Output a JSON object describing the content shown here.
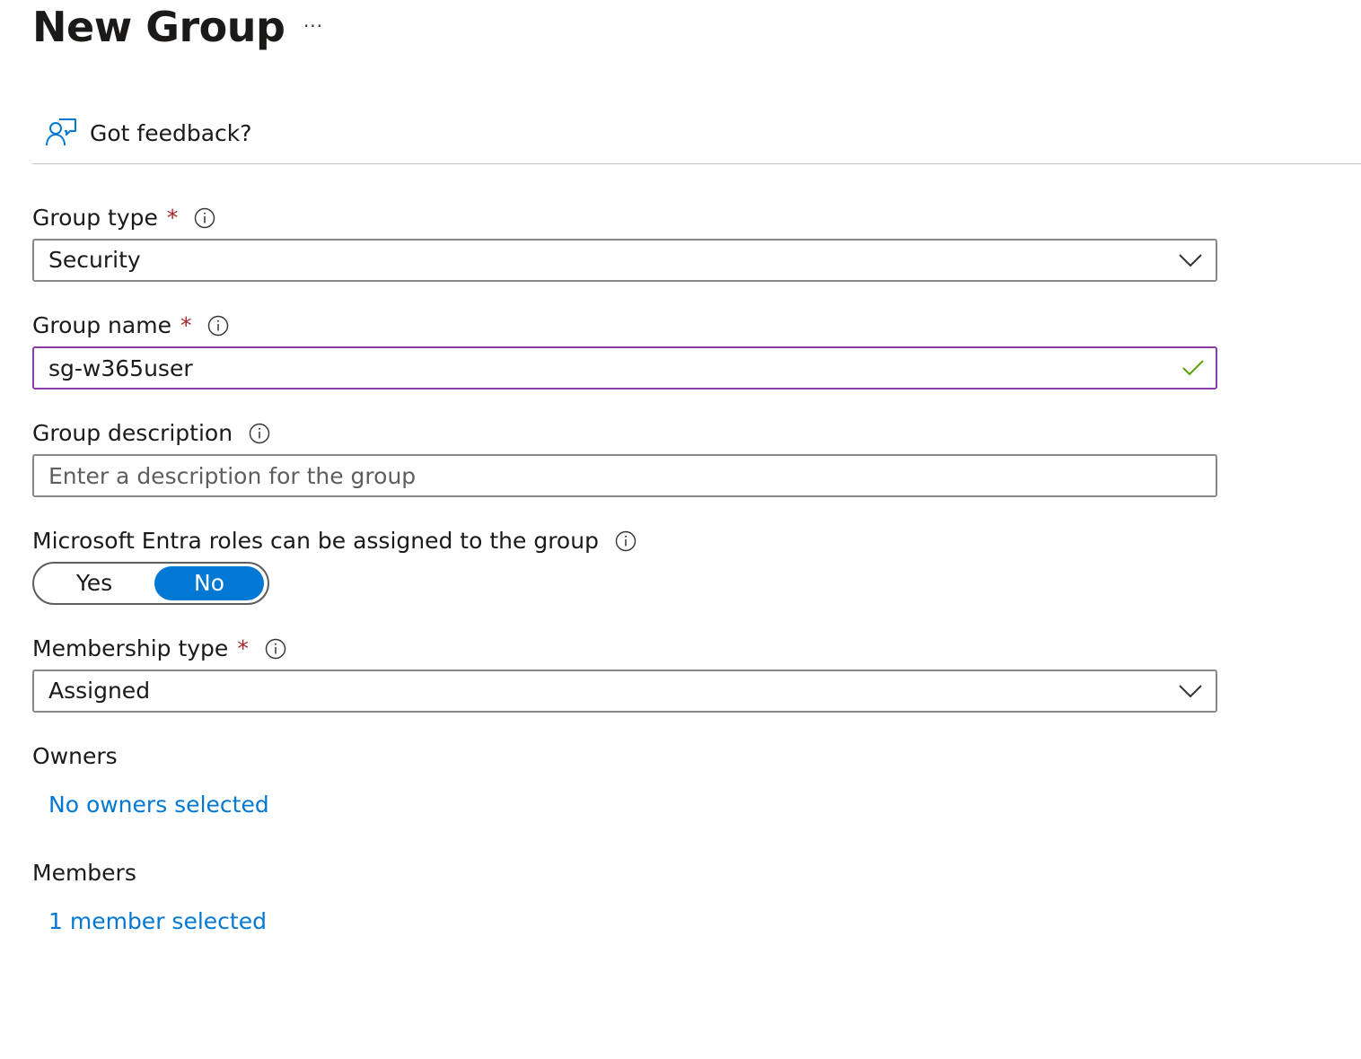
{
  "header": {
    "title": "New Group",
    "more_label": "···"
  },
  "toolbar": {
    "feedback_label": "Got feedback?"
  },
  "form": {
    "group_type": {
      "label": "Group type",
      "required_mark": "*",
      "value": "Security"
    },
    "group_name": {
      "label": "Group name",
      "required_mark": "*",
      "value": "sg-w365user"
    },
    "group_description": {
      "label": "Group description",
      "placeholder": "Enter a description for the group",
      "value": ""
    },
    "entra_roles": {
      "label": "Microsoft Entra roles can be assigned to the group",
      "options": [
        "Yes",
        "No"
      ],
      "selected": "No"
    },
    "membership_type": {
      "label": "Membership type",
      "required_mark": "*",
      "value": "Assigned"
    },
    "owners": {
      "label": "Owners",
      "link": "No owners selected"
    },
    "members": {
      "label": "Members",
      "link": "1 member selected"
    }
  },
  "colors": {
    "accent": "#0078d4",
    "required": "#a4262c",
    "valid_border": "#8c3ca8",
    "valid_check": "#57a300",
    "border": "#8a8886"
  },
  "icons": {
    "feedback": "feedback-person-icon",
    "info": "info-icon",
    "dropdown": "chevron-down-icon",
    "valid": "checkmark-icon"
  }
}
